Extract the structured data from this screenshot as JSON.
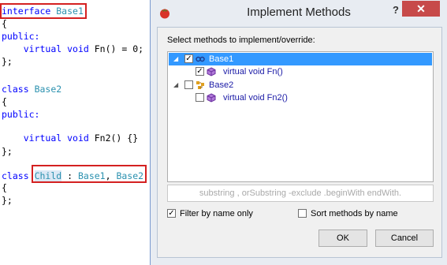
{
  "editor": {
    "lines": [
      [
        {
          "t": "interface",
          "c": "kw"
        },
        {
          "t": " "
        },
        {
          "t": "Base1",
          "c": "ty"
        }
      ],
      [
        {
          "t": "{"
        }
      ],
      [
        {
          "t": "public:",
          "c": "kw"
        }
      ],
      [
        {
          "t": "    "
        },
        {
          "t": "virtual",
          "c": "kw"
        },
        {
          "t": " "
        },
        {
          "t": "void",
          "c": "kw"
        },
        {
          "t": " Fn() = 0;"
        }
      ],
      [
        {
          "t": "};"
        }
      ],
      [
        {
          "t": ""
        }
      ],
      [
        {
          "t": "class",
          "c": "kw"
        },
        {
          "t": " "
        },
        {
          "t": "Base2",
          "c": "ty"
        }
      ],
      [
        {
          "t": "{"
        }
      ],
      [
        {
          "t": "public:",
          "c": "kw"
        }
      ],
      [
        {
          "t": ""
        }
      ],
      [
        {
          "t": "    "
        },
        {
          "t": "virtual",
          "c": "kw"
        },
        {
          "t": " "
        },
        {
          "t": "void",
          "c": "kw"
        },
        {
          "t": " Fn2() {}"
        }
      ],
      [
        {
          "t": "};"
        }
      ],
      [
        {
          "t": ""
        }
      ],
      [
        {
          "t": "class",
          "c": "kw"
        },
        {
          "t": " "
        },
        {
          "t": "Child",
          "c": "ty",
          "bg": true
        },
        {
          "t": " : "
        },
        {
          "t": "Base1",
          "c": "ty"
        },
        {
          "t": ", "
        },
        {
          "t": "Base2",
          "c": "ty"
        }
      ],
      [
        {
          "t": "{"
        }
      ],
      [
        {
          "t": "};"
        }
      ]
    ]
  },
  "dialog": {
    "title": "Implement Methods",
    "help_glyph": "?",
    "close_glyph": "✕",
    "app_icon": "tomato-icon",
    "prompt": "Select methods to implement/override:",
    "tree": [
      {
        "label": "Base1",
        "level": 0,
        "checked": true,
        "selected": true,
        "expanded": true,
        "icon": "interface-icon"
      },
      {
        "label": "virtual void Fn()",
        "level": 1,
        "checked": true,
        "selected": false,
        "icon": "method-icon"
      },
      {
        "label": "Base2",
        "level": 0,
        "checked": false,
        "selected": false,
        "expanded": true,
        "icon": "class-icon"
      },
      {
        "label": "virtual void Fn2()",
        "level": 1,
        "checked": false,
        "selected": false,
        "icon": "method-icon"
      }
    ],
    "filter_placeholder": "substring , orSubstring -exclude .beginWith endWith.",
    "filter_value": "",
    "options": {
      "filter_by_name_label": "Filter by name only",
      "filter_by_name_checked": true,
      "sort_by_name_label": "Sort methods by name",
      "sort_by_name_checked": false
    },
    "buttons": {
      "ok": "OK",
      "cancel": "Cancel"
    },
    "colors": {
      "selection": "#3399ff",
      "keyword": "#0000ff",
      "type": "#2b91af",
      "highlight_border": "#d42121"
    }
  }
}
